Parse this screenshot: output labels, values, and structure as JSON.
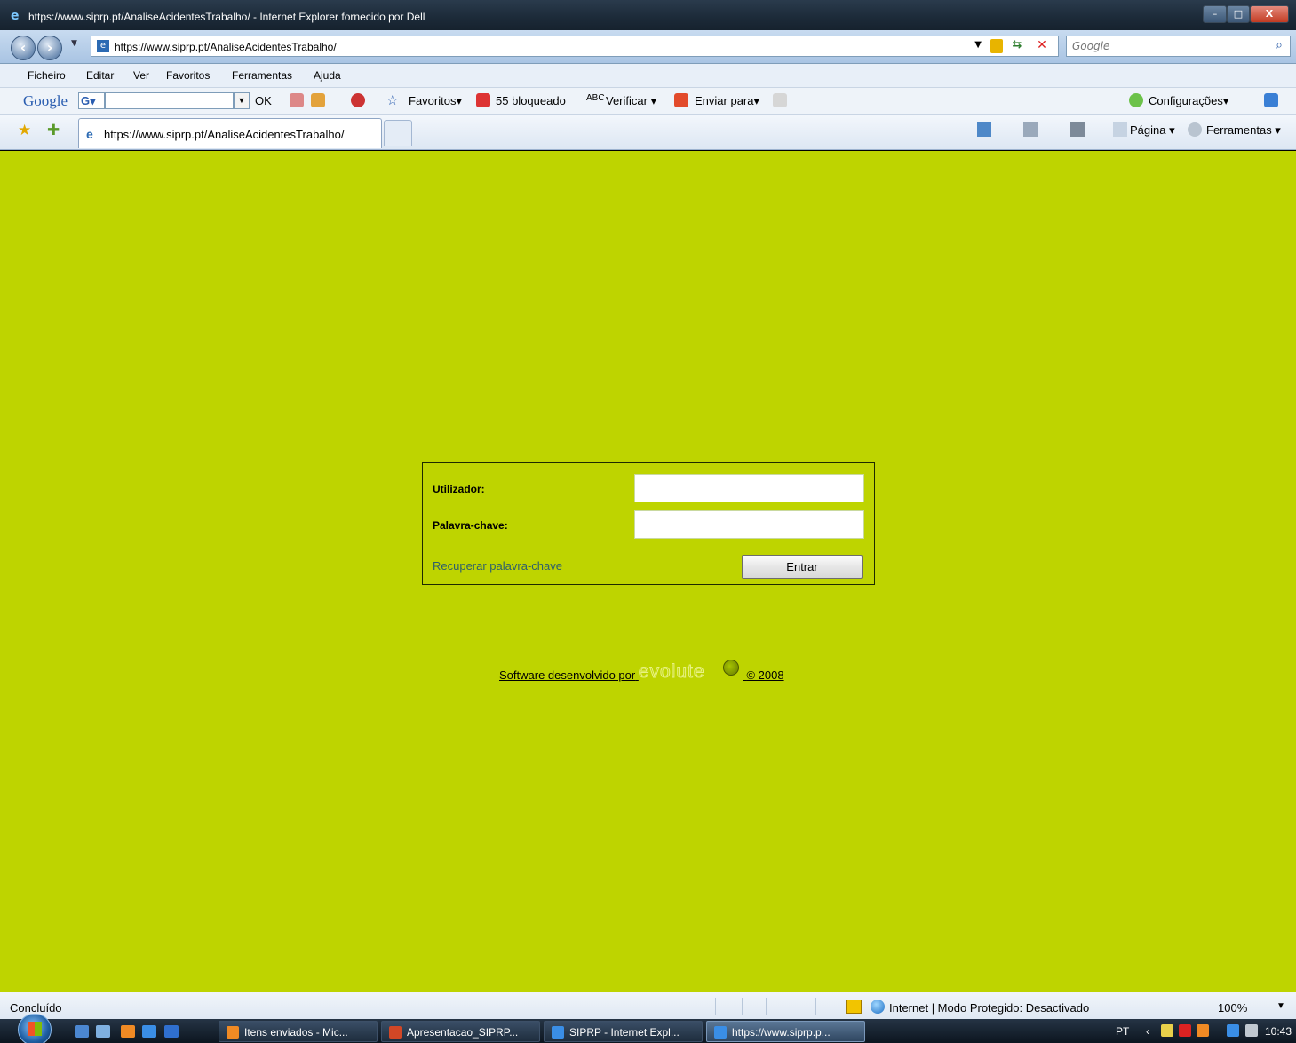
{
  "window": {
    "title": "https://www.siprp.pt/AnaliseAcidentesTrabalho/ - Internet Explorer fornecido por Dell",
    "minimize_label": "–",
    "maximize_label": "□",
    "close_label": "X"
  },
  "address_bar": {
    "url": "https://www.siprp.pt/AnaliseAcidentesTrabalho/",
    "search_placeholder": "Google"
  },
  "menu": [
    "Ficheiro",
    "Editar",
    "Ver",
    "Favoritos",
    "Ferramentas",
    "Ajuda"
  ],
  "google_toolbar": {
    "logo": "Google",
    "g_button": "G▾",
    "ok_label": "OK",
    "favorites_label": "Favoritos▾",
    "blocked_label": "55 bloqueado",
    "check_label": "Verificar ▾",
    "send_label": "Enviar para▾",
    "settings_label": "Configurações▾"
  },
  "tab_bar": {
    "tab_title": "https://www.siprp.pt/AnaliseAcidentesTrabalho/",
    "page_label": "Página ▾",
    "tools_label": "Ferramentas ▾"
  },
  "login": {
    "username_label": "Utilizador:",
    "username_value": "",
    "password_label": "Palavra-chave:",
    "password_value": "",
    "recover_link": "Recuperar palavra-chave",
    "submit_label": "Entrar"
  },
  "footer": {
    "prefix": "Software desenvolvido por",
    "brand": "evolute",
    "copyright": "© 2008"
  },
  "status_bar": {
    "status": "Concluído",
    "zone": "Internet | Modo Protegido: Desactivado",
    "zoom": "100%"
  },
  "taskbar": {
    "buttons": [
      {
        "label": "Itens enviados - Mic..."
      },
      {
        "label": "Apresentacao_SIPRP..."
      },
      {
        "label": "SIPRP - Internet Expl..."
      },
      {
        "label": "https://www.siprp.p..."
      }
    ],
    "language": "PT",
    "clock": "10:43"
  },
  "colors": {
    "page_background": "#bed400",
    "link": "#2e5f6b"
  }
}
